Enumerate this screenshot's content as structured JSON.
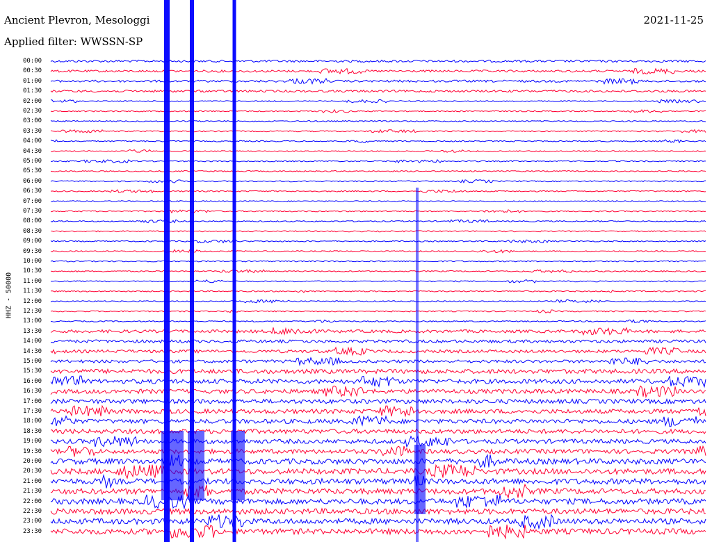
{
  "header": {
    "station": "Ancient Plevron, Mesologgi",
    "filter": "Applied filter: WWSSN-SP",
    "date": "2021-11-25"
  },
  "axis": {
    "ylabel": "HHZ - 50000"
  },
  "colors": {
    "trace_a": "#0000ff",
    "trace_b": "#ff0033"
  },
  "time_labels": [
    "00:00",
    "00:30",
    "01:00",
    "01:30",
    "02:00",
    "02:30",
    "03:00",
    "03:30",
    "04:00",
    "04:30",
    "05:00",
    "05:30",
    "06:00",
    "06:30",
    "07:00",
    "07:30",
    "08:00",
    "08:30",
    "09:00",
    "09:30",
    "10:00",
    "10:30",
    "11:00",
    "11:30",
    "12:00",
    "12:30",
    "13:00",
    "13:30",
    "14:00",
    "14:30",
    "15:00",
    "15:30",
    "16:00",
    "16:30",
    "17:00",
    "17:30",
    "18:00",
    "18:30",
    "19:00",
    "19:30",
    "20:00",
    "20:30",
    "21:00",
    "21:30",
    "22:00",
    "22:30",
    "23:00",
    "23:30"
  ]
}
